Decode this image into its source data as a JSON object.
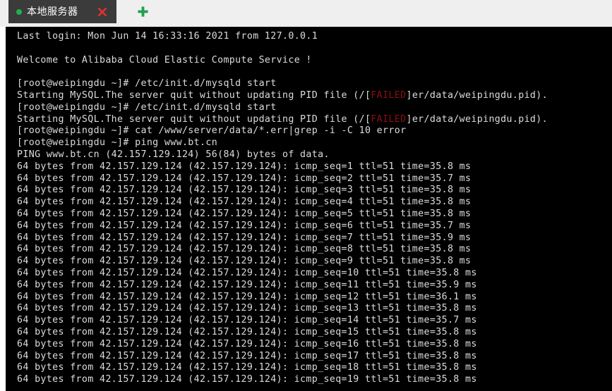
{
  "window": {
    "tabbar_bg": "#efeff0"
  },
  "tabs": [
    {
      "title": "本地服务器",
      "status_dot_color": "#22b14c",
      "close_icon": "close-icon",
      "active": true
    }
  ],
  "new_tab": {
    "icon": "plus-icon",
    "color": "#22a04a",
    "label": "+"
  },
  "terminal": {
    "background": "#000000",
    "foreground": "#dcdcdc",
    "error_color": "#8a0f13",
    "host": "weipingdu",
    "user": "root",
    "prompt": "[root@weipingdu ~]#",
    "lines": [
      {
        "text": "Last login: Mon Jun 14 16:33:16 2021 from 127.0.0.1"
      },
      {
        "text": ""
      },
      {
        "text": "Welcome to Alibaba Cloud Elastic Compute Service !"
      },
      {
        "text": ""
      },
      {
        "text": "[root@weipingdu ~]# /etc/init.d/mysqld start"
      },
      {
        "segments": [
          {
            "text": "Starting MySQL.The server quit without updating PID file (/["
          },
          {
            "text": "FAILED",
            "style": "error"
          },
          {
            "text": "]er/data/weipingdu.pid)."
          }
        ]
      },
      {
        "text": "[root@weipingdu ~]# /etc/init.d/mysqld start"
      },
      {
        "segments": [
          {
            "text": "Starting MySQL.The server quit without updating PID file (/["
          },
          {
            "text": "FAILED",
            "style": "error"
          },
          {
            "text": "]er/data/weipingdu.pid)."
          }
        ]
      },
      {
        "text": "[root@weipingdu ~]# cat /www/server/data/*.err|grep -i -C 10 error"
      },
      {
        "text": "[root@weipingdu ~]# ping www.bt.cn"
      },
      {
        "text": "PING www.bt.cn (42.157.129.124) 56(84) bytes of data."
      },
      {
        "text": "64 bytes from 42.157.129.124 (42.157.129.124): icmp_seq=1 ttl=51 time=35.8 ms"
      },
      {
        "text": "64 bytes from 42.157.129.124 (42.157.129.124): icmp_seq=2 ttl=51 time=35.7 ms"
      },
      {
        "text": "64 bytes from 42.157.129.124 (42.157.129.124): icmp_seq=3 ttl=51 time=35.8 ms"
      },
      {
        "text": "64 bytes from 42.157.129.124 (42.157.129.124): icmp_seq=4 ttl=51 time=35.8 ms"
      },
      {
        "text": "64 bytes from 42.157.129.124 (42.157.129.124): icmp_seq=5 ttl=51 time=35.8 ms"
      },
      {
        "text": "64 bytes from 42.157.129.124 (42.157.129.124): icmp_seq=6 ttl=51 time=35.7 ms"
      },
      {
        "text": "64 bytes from 42.157.129.124 (42.157.129.124): icmp_seq=7 ttl=51 time=35.9 ms"
      },
      {
        "text": "64 bytes from 42.157.129.124 (42.157.129.124): icmp_seq=8 ttl=51 time=35.8 ms"
      },
      {
        "text": "64 bytes from 42.157.129.124 (42.157.129.124): icmp_seq=9 ttl=51 time=35.8 ms"
      },
      {
        "text": "64 bytes from 42.157.129.124 (42.157.129.124): icmp_seq=10 ttl=51 time=35.8 ms"
      },
      {
        "text": "64 bytes from 42.157.129.124 (42.157.129.124): icmp_seq=11 ttl=51 time=35.9 ms"
      },
      {
        "text": "64 bytes from 42.157.129.124 (42.157.129.124): icmp_seq=12 ttl=51 time=36.1 ms"
      },
      {
        "text": "64 bytes from 42.157.129.124 (42.157.129.124): icmp_seq=13 ttl=51 time=35.8 ms"
      },
      {
        "text": "64 bytes from 42.157.129.124 (42.157.129.124): icmp_seq=14 ttl=51 time=35.7 ms"
      },
      {
        "text": "64 bytes from 42.157.129.124 (42.157.129.124): icmp_seq=15 ttl=51 time=35.8 ms"
      },
      {
        "text": "64 bytes from 42.157.129.124 (42.157.129.124): icmp_seq=16 ttl=51 time=35.8 ms"
      },
      {
        "text": "64 bytes from 42.157.129.124 (42.157.129.124): icmp_seq=17 ttl=51 time=35.8 ms"
      },
      {
        "text": "64 bytes from 42.157.129.124 (42.157.129.124): icmp_seq=18 ttl=51 time=35.8 ms"
      },
      {
        "text": "64 bytes from 42.157.129.124 (42.157.129.124): icmp_seq=19 ttl=51 time=35.8 ms"
      }
    ]
  }
}
